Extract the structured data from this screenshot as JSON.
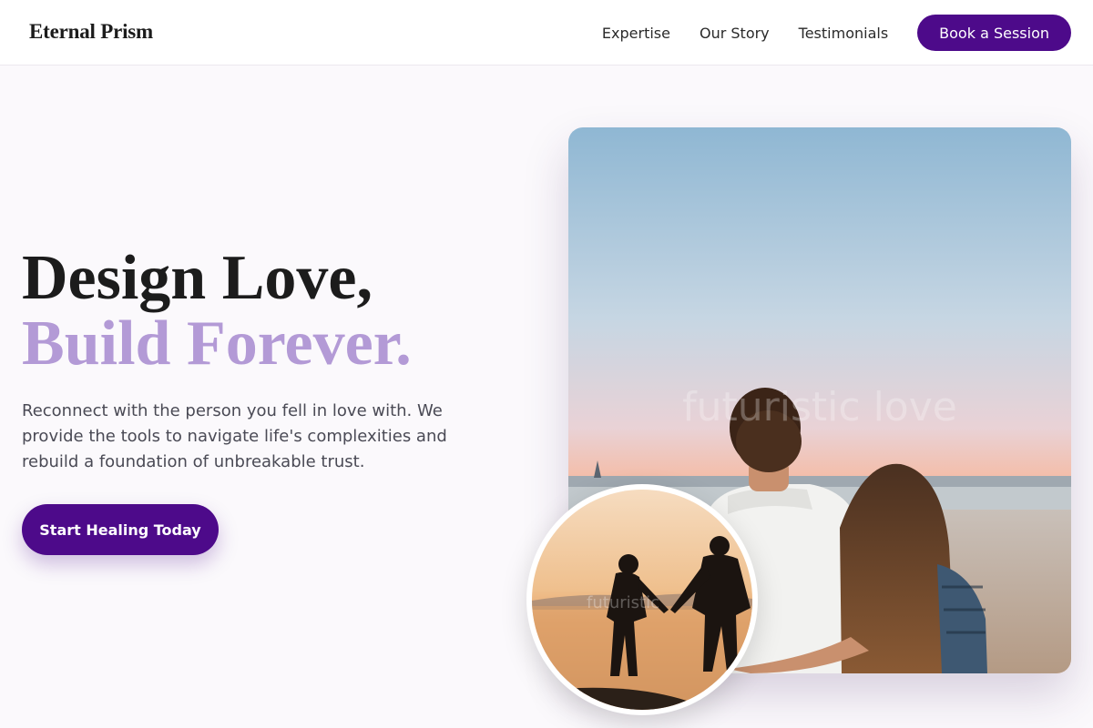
{
  "brand": {
    "name": "Eternal Prism"
  },
  "nav": {
    "links": [
      "Expertise",
      "Our Story",
      "Testimonials"
    ],
    "cta": "Book a Session"
  },
  "hero": {
    "title_line1": "Design Love,",
    "title_line2": "Build Forever.",
    "subtitle": "Reconnect with the person you fell in love with. We provide the tools to navigate life's complexities and rebuild a foundation of unbreakable trust.",
    "cta": "Start Healing Today"
  },
  "images": {
    "main_watermark": "futuristic love",
    "small_watermark": "futuristic"
  },
  "colors": {
    "accent": "#4d0a8a",
    "highlight": "#b39ad6",
    "background": "#fbf9fc"
  }
}
